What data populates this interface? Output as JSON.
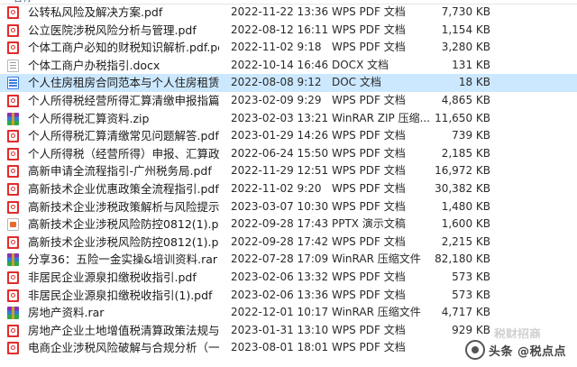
{
  "header": {
    "name": "名称"
  },
  "rows": [
    {
      "name": "公转私风险及解决方案.pdf",
      "date": "2022-11-22 13:36",
      "type": "WPS PDF 文档",
      "size": "7,730 KB",
      "icon": "pdf-icon",
      "state": "normal"
    },
    {
      "name": "公立医院涉税风险分析与管理.pdf",
      "date": "2022-08-12 16:11",
      "type": "WPS PDF 文档",
      "size": "1,154 KB",
      "icon": "pdf-icon",
      "state": "normal"
    },
    {
      "name": "个体工商户必知的财税知识解析.pdf.pdf",
      "date": "2022-11-02 9:18",
      "type": "WPS PDF 文档",
      "size": "3,280 KB",
      "icon": "pdf-icon",
      "state": "normal"
    },
    {
      "name": "个体工商户办税指引.docx",
      "date": "2022-10-14 16:46",
      "type": "DOCX 文档",
      "size": "131 KB",
      "icon": "docx-icon",
      "state": "normal"
    },
    {
      "name": "个人住房租房合同范本与个人住房租赁协...",
      "date": "2022-08-08 9:12",
      "type": "DOC 文档",
      "size": "18 KB",
      "icon": "doc-icon",
      "state": "selected"
    },
    {
      "name": "个人所得税经营所得汇算清缴申报指篇培训...",
      "date": "2023-02-09 9:29",
      "type": "WPS PDF 文档",
      "size": "4,865 KB",
      "icon": "pdf-icon",
      "state": "normal"
    },
    {
      "name": "个人所得税汇算资料.zip",
      "date": "2023-02-03 13:21",
      "type": "WinRAR ZIP 压缩...",
      "size": "11,650 KB",
      "icon": "zip-icon",
      "state": "normal"
    },
    {
      "name": "个人所得税汇算清缴常见问题解答.pdf",
      "date": "2023-01-29 14:26",
      "type": "WPS PDF 文档",
      "size": "739 KB",
      "icon": "pdf-icon",
      "state": "normal"
    },
    {
      "name": "个人所得税（经营所得）申报、汇算政策...",
      "date": "2022-06-24 15:50",
      "type": "WPS PDF 文档",
      "size": "2,185 KB",
      "icon": "pdf-icon",
      "state": "normal"
    },
    {
      "name": "高新申请全流程指引-广州税务局.pdf",
      "date": "2022-11-29 12:51",
      "type": "WPS PDF 文档",
      "size": "16,972 KB",
      "icon": "pdf-icon",
      "state": "normal"
    },
    {
      "name": "高新技术企业优惠政策全流程指引.pdf",
      "date": "2022-11-02 9:20",
      "type": "WPS PDF 文档",
      "size": "30,382 KB",
      "icon": "pdf-icon",
      "state": "normal"
    },
    {
      "name": "高新技术企业涉税政策解析与风险提示（...",
      "date": "2023-03-07 10:30",
      "type": "WPS PDF 文档",
      "size": "1,480 KB",
      "icon": "pdf-icon",
      "state": "normal"
    },
    {
      "name": "高新技术企业涉税风险防控0812(1).pptx",
      "date": "2022-09-28 17:43",
      "type": "PPTX 演示文稿",
      "size": "1,600 KB",
      "icon": "pptx-icon",
      "state": "normal"
    },
    {
      "name": "高新技术企业涉税风险防控0812(1).pdf",
      "date": "2022-09-28 17:42",
      "type": "WPS PDF 文档",
      "size": "2,215 KB",
      "icon": "pdf-icon",
      "state": "normal"
    },
    {
      "name": "分享36：五险一金实操&培训资料.rar",
      "date": "2022-07-28 17:09",
      "type": "WinRAR 压缩文件",
      "size": "82,180 KB",
      "icon": "rar-icon",
      "state": "normal"
    },
    {
      "name": "非居民企业源泉扣缴税收指引.pdf",
      "date": "2023-02-06 13:32",
      "type": "WPS PDF 文档",
      "size": "573 KB",
      "icon": "pdf-icon",
      "state": "normal"
    },
    {
      "name": "非居民企业源泉扣缴税收指引(1).pdf",
      "date": "2023-02-06 13:36",
      "type": "WPS PDF 文档",
      "size": "573 KB",
      "icon": "pdf-icon",
      "state": "normal"
    },
    {
      "name": "房地产资料.rar",
      "date": "2022-12-01 10:17",
      "type": "WinRAR 压缩文件",
      "size": "4,717 KB",
      "icon": "rar-icon",
      "state": "normal"
    },
    {
      "name": "房地产企业土地增值税清算政策法规与实...",
      "date": "2023-01-31 13:10",
      "type": "WPS PDF 文档",
      "size": "929 KB",
      "icon": "pdf-icon",
      "state": "normal"
    },
    {
      "name": "电商企业涉税风险破解与合规分析（一小...",
      "date": "2023-08-01 18:01",
      "type": "WPS PDF 文档",
      "size": "",
      "icon": "pdf-icon",
      "state": "normal"
    }
  ],
  "watermark": {
    "text": "头条 @税点点",
    "logo_text": "税财招商"
  }
}
